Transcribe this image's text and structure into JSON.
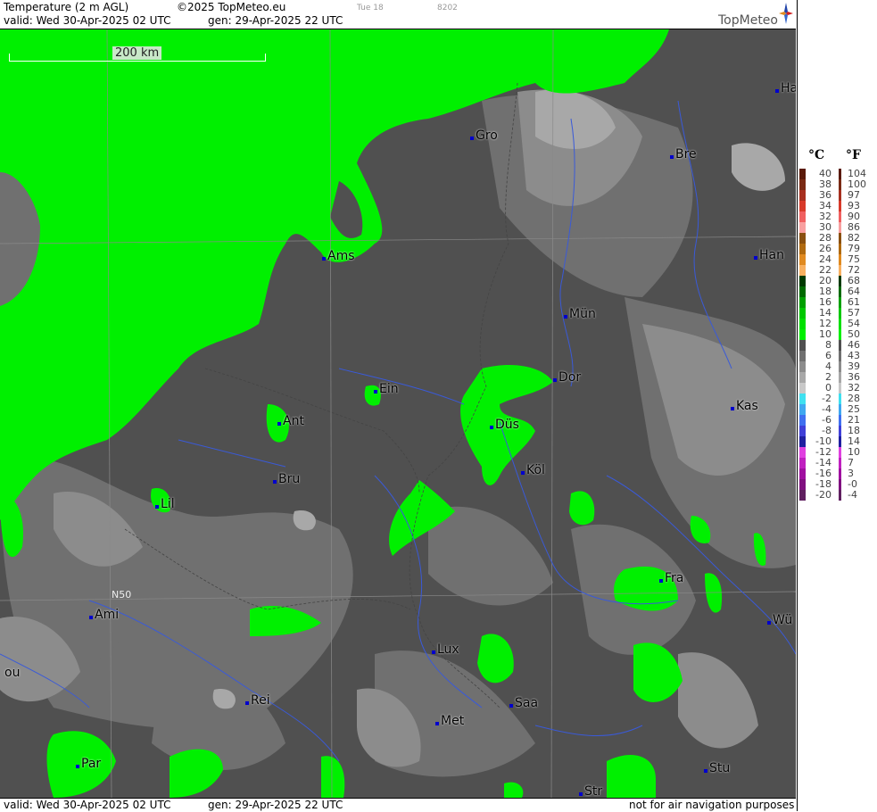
{
  "header": {
    "title": "Temperature (2 m AGL)",
    "copyright": "©2025 TopMeteo.eu",
    "tiny_a": "Tue 18",
    "tiny_b": "8202",
    "valid": "valid:  Wed  30-Apr-2025  02 UTC",
    "gen": "gen:  29-Apr-2025 22 UTC",
    "logo": "TopMeteo"
  },
  "footer": {
    "valid": "valid:  Wed  30-Apr-2025  02 UTC",
    "gen": "gen:  29-Apr-2025 22 UTC",
    "disclaimer": "not for air navigation purposes"
  },
  "map": {
    "scale_label": "200 km",
    "lat_label": "N50",
    "cities": [
      {
        "name": "Ha"
      },
      {
        "name": "Gro"
      },
      {
        "name": "Bre"
      },
      {
        "name": "Ams"
      },
      {
        "name": "Han"
      },
      {
        "name": "Mün"
      },
      {
        "name": "Ein"
      },
      {
        "name": "Dor"
      },
      {
        "name": "Ant"
      },
      {
        "name": "Düs"
      },
      {
        "name": "Kas"
      },
      {
        "name": "Bru"
      },
      {
        "name": "Köl"
      },
      {
        "name": "Lil"
      },
      {
        "name": "Fra"
      },
      {
        "name": "Ami"
      },
      {
        "name": "Wü"
      },
      {
        "name": "Lux"
      },
      {
        "name": "ou"
      },
      {
        "name": "Rei"
      },
      {
        "name": "Saa"
      },
      {
        "name": "Met"
      },
      {
        "name": "Par"
      },
      {
        "name": "Stu"
      },
      {
        "name": "Str"
      }
    ]
  },
  "legend": {
    "celsius_header": "°C",
    "fahrenheit_header": "°F",
    "rows": [
      {
        "c": "40",
        "f": "104",
        "color": "#5a1a0a"
      },
      {
        "c": "38",
        "f": "100",
        "color": "#7a2a14"
      },
      {
        "c": "36",
        "f": "97",
        "color": "#a83020"
      },
      {
        "c": "34",
        "f": "93",
        "color": "#d83a2a"
      },
      {
        "c": "32",
        "f": "90",
        "color": "#f06060"
      },
      {
        "c": "30",
        "f": "86",
        "color": "#f8a0a0"
      },
      {
        "c": "28",
        "f": "82",
        "color": "#8a5010"
      },
      {
        "c": "26",
        "f": "79",
        "color": "#b06a10"
      },
      {
        "c": "24",
        "f": "75",
        "color": "#e08a20"
      },
      {
        "c": "22",
        "f": "72",
        "color": "#f8b060"
      },
      {
        "c": "20",
        "f": "68",
        "color": "#003a00"
      },
      {
        "c": "18",
        "f": "64",
        "color": "#006a00"
      },
      {
        "c": "16",
        "f": "61",
        "color": "#00a000"
      },
      {
        "c": "14",
        "f": "57",
        "color": "#00c800"
      },
      {
        "c": "12",
        "f": "54",
        "color": "#00e000"
      },
      {
        "c": "10",
        "f": "50",
        "color": "#00f000"
      },
      {
        "c": "8",
        "f": "46",
        "color": "#505050"
      },
      {
        "c": "6",
        "f": "43",
        "color": "#707070"
      },
      {
        "c": "4",
        "f": "39",
        "color": "#8c8c8c"
      },
      {
        "c": "2",
        "f": "36",
        "color": "#a8a8a8"
      },
      {
        "c": "0",
        "f": "32",
        "color": "#c8c8c8"
      },
      {
        "c": "-2",
        "f": "28",
        "color": "#40e0f0"
      },
      {
        "c": "-4",
        "f": "25",
        "color": "#40a8f0"
      },
      {
        "c": "-6",
        "f": "21",
        "color": "#4070f0"
      },
      {
        "c": "-8",
        "f": "18",
        "color": "#4040d8"
      },
      {
        "c": "-10",
        "f": "14",
        "color": "#2020a0"
      },
      {
        "c": "-12",
        "f": "10",
        "color": "#e040e0"
      },
      {
        "c": "-14",
        "f": "7",
        "color": "#c020c0"
      },
      {
        "c": "-16",
        "f": "3",
        "color": "#a010a0"
      },
      {
        "c": "-18",
        "f": "-0",
        "color": "#801080"
      },
      {
        "c": "-20",
        "f": "-4",
        "color": "#602060"
      }
    ]
  },
  "colors": {
    "green": "#00f000",
    "dark_gray": "#505050",
    "mid_gray": "#707070",
    "light_gray": "#8c8c8c",
    "lighter_gray": "#a8a8a8",
    "river": "#3a5ad8"
  }
}
